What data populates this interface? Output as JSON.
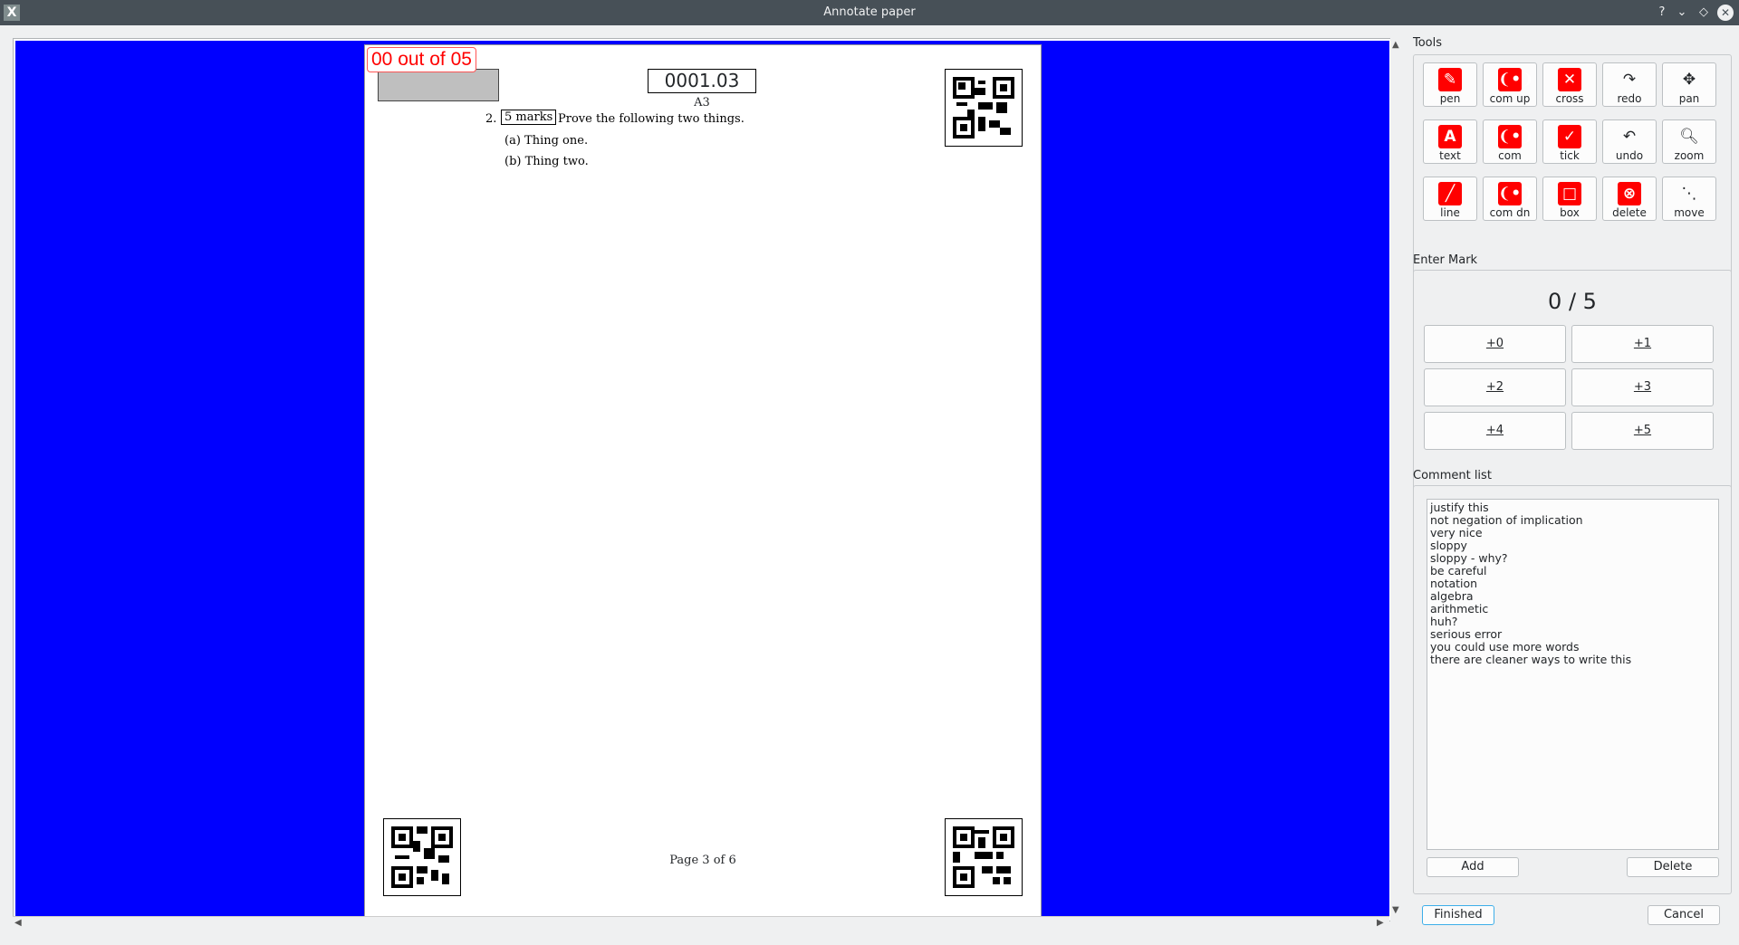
{
  "window": {
    "title": "Annotate paper",
    "app_icon": "x-app-icon",
    "controls": [
      "?",
      "⌄",
      "◇",
      "✕"
    ]
  },
  "page": {
    "score_label": "00 out of 05",
    "test_id": "0001.03",
    "page_code": "A3",
    "question_number": "2.",
    "marks_box": "5 marks",
    "question_text": "Prove the following two things.",
    "part_a": "(a)  Thing one.",
    "part_b": "(b)  Thing two.",
    "footer": "Page 3 of 6"
  },
  "tools": {
    "label": "Tools",
    "buttons": [
      {
        "name": "pen",
        "label": "pen",
        "glyph": "✎",
        "icon_style": "red"
      },
      {
        "name": "com-up",
        "label": "com up",
        "glyph": "❨•❩",
        "icon_style": "red"
      },
      {
        "name": "cross",
        "label": "cross",
        "glyph": "✕",
        "icon_style": "red"
      },
      {
        "name": "redo",
        "label": "redo",
        "glyph": "↷",
        "icon_style": "plain"
      },
      {
        "name": "pan",
        "label": "pan",
        "glyph": "✥",
        "icon_style": "plain"
      },
      {
        "name": "text",
        "label": "text",
        "glyph": "A",
        "icon_style": "red"
      },
      {
        "name": "com",
        "label": "com",
        "glyph": "❨•❩",
        "icon_style": "red"
      },
      {
        "name": "tick",
        "label": "tick",
        "glyph": "✓",
        "icon_style": "red"
      },
      {
        "name": "undo",
        "label": "undo",
        "glyph": "↶",
        "icon_style": "plain"
      },
      {
        "name": "zoom",
        "label": "zoom",
        "glyph": "🔍︎",
        "icon_style": "plain"
      },
      {
        "name": "line",
        "label": "line",
        "glyph": "╱",
        "icon_style": "red"
      },
      {
        "name": "com-dn",
        "label": "com dn",
        "glyph": "❨•❩",
        "icon_style": "red"
      },
      {
        "name": "box",
        "label": "box",
        "glyph": "□",
        "icon_style": "red"
      },
      {
        "name": "delete",
        "label": "delete",
        "glyph": "⊗",
        "icon_style": "red"
      },
      {
        "name": "move",
        "label": "move",
        "glyph": "⋱",
        "icon_style": "plain"
      }
    ]
  },
  "enter_mark": {
    "label": "Enter Mark",
    "display": "0 / 5",
    "buttons": [
      "+0",
      "+1",
      "+2",
      "+3",
      "+4",
      "+5"
    ]
  },
  "comments": {
    "label": "Comment list",
    "items": [
      "justify this",
      "not negation of implication",
      "very nice",
      "sloppy",
      "sloppy - why?",
      "be careful",
      "notation",
      "algebra",
      "arithmetic",
      "huh?",
      "serious error",
      "you could use more words",
      "there are cleaner ways to write this"
    ],
    "add_label": "Add",
    "delete_label": "Delete"
  },
  "footer": {
    "finished_label": "Finished",
    "cancel_label": "Cancel"
  },
  "colors": {
    "scene_background": "#0000ff",
    "annotation_red": "#ff0000",
    "titlebar": "#475057"
  }
}
